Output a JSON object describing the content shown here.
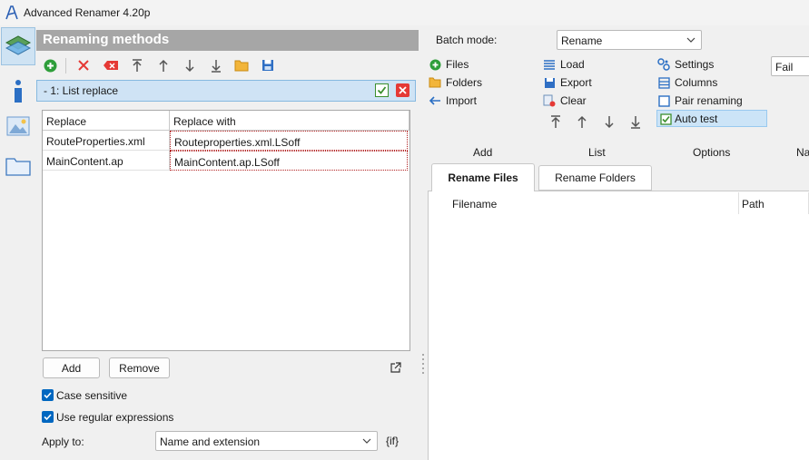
{
  "window": {
    "title": "Advanced Renamer 4.20p"
  },
  "left": {
    "header": "Renaming methods",
    "method": {
      "label": "-  1: List replace"
    },
    "grid": {
      "columns": [
        "Replace",
        "Replace with"
      ],
      "rows": [
        [
          "RouteProperties.xml",
          "Routeproperties.xml.LSoff"
        ],
        [
          "MainContent.ap",
          "MainContent.ap.LSoff"
        ]
      ]
    },
    "buttons": {
      "add": "Add",
      "remove": "Remove"
    },
    "options": {
      "case_sensitive": "Case sensitive",
      "regex": "Use regular expressions",
      "apply_to_label": "Apply to:",
      "apply_to_value": "Name and extension",
      "if_label": "{if}"
    }
  },
  "right": {
    "batch_mode_label": "Batch mode:",
    "batch_mode_value": "Rename",
    "fail_value": "Fail",
    "add_group": {
      "files": "Files",
      "folders": "Folders",
      "import": "Import"
    },
    "list_group": {
      "load": "Load",
      "export": "Export",
      "clear": "Clear"
    },
    "options_group": {
      "settings": "Settings",
      "columns": "Columns",
      "pair": "Pair renaming",
      "auto_test": "Auto test"
    },
    "section_labels": {
      "add": "Add",
      "list": "List",
      "options": "Options",
      "na": "Na"
    },
    "tabs": {
      "rename_files": "Rename Files",
      "rename_folders": "Rename Folders"
    },
    "list_columns": {
      "filename": "Filename",
      "path": "Path"
    }
  },
  "colors": {
    "accent": "#0067c0",
    "header_gray": "#a6a6a6",
    "selected_blue": "#cfe3f5",
    "green": "#2e9e3a",
    "red": "#e53935"
  }
}
